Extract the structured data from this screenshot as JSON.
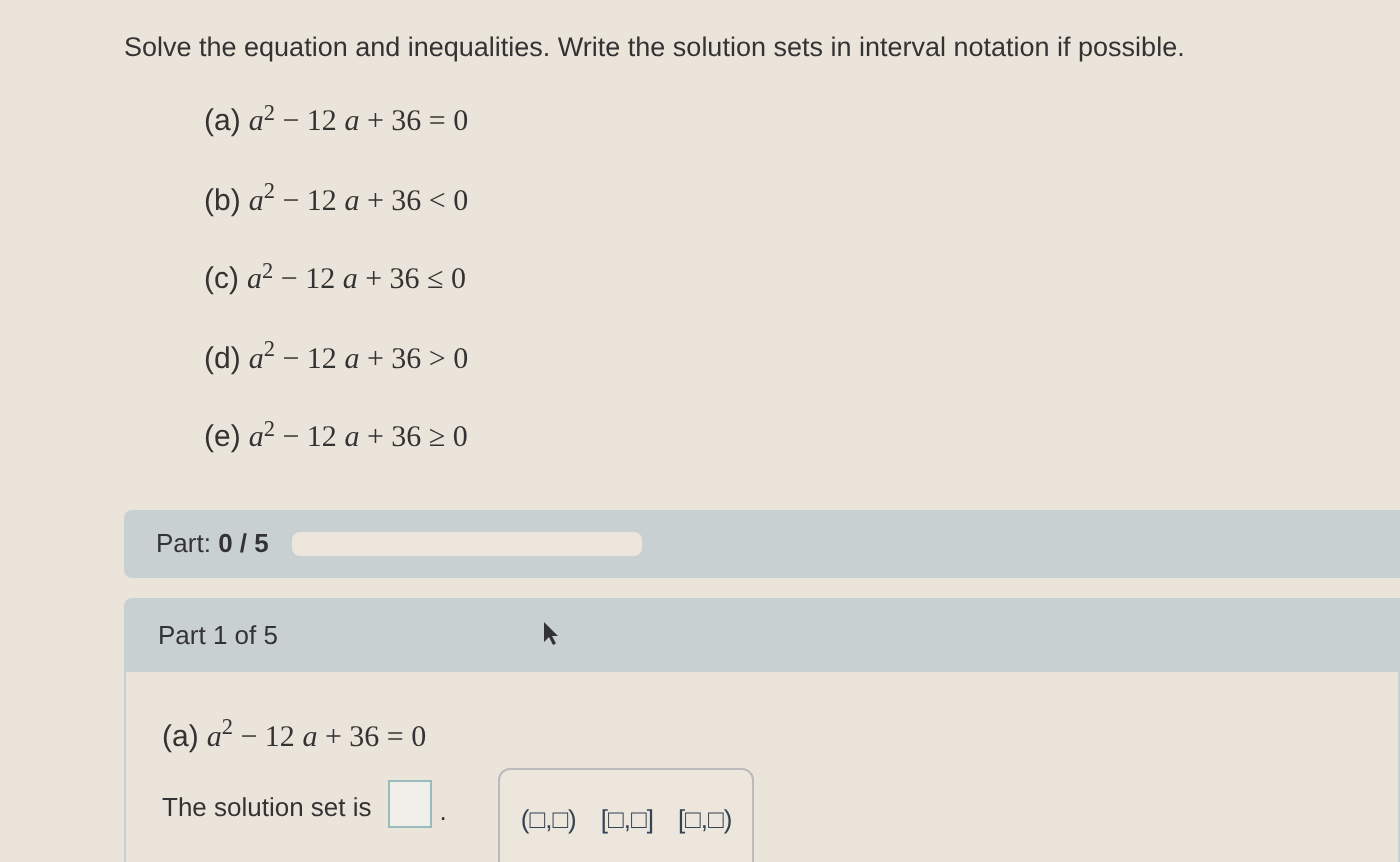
{
  "instructions": "Solve the equation and inequalities. Write the solution sets in interval notation if possible.",
  "problems": [
    {
      "label": "(a)",
      "expression": "*a*$^{2}$ − 12 *a* + 36 = 0"
    },
    {
      "label": "(b)",
      "expression": "*a*$^{2}$ − 12 *a* + 36 < 0"
    },
    {
      "label": "(c)",
      "expression": "*a*$^{2}$ − 12 *a* + 36 ≤ 0"
    },
    {
      "label": "(d)",
      "expression": "*a*$^{2}$ − 12 *a* + 36 > 0"
    },
    {
      "label": "(e)",
      "expression": "*a*$^{2}$ − 12 *a* + 36 ≥ 0"
    }
  ],
  "progress": {
    "label": "Part:",
    "value": "0 / 5",
    "level": 0
  },
  "part": {
    "title": "Part 1 of 5",
    "label": "(a)",
    "expression": "*a*$^{2}$ − 12 *a* + 36 = 0",
    "prompt": "The solution set is",
    "period": ".",
    "intervals": [
      "(□,□)",
      "[□,□]",
      "[□,□)"
    ]
  }
}
